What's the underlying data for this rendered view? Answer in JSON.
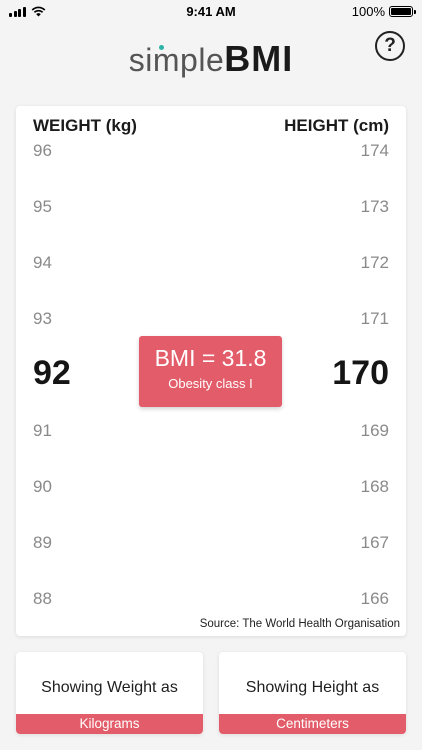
{
  "status": {
    "time": "9:41 AM",
    "battery": "100%"
  },
  "header": {
    "logo_light": "simple",
    "logo_bold": "BMI",
    "help_label": "?"
  },
  "scales": {
    "weight_header": "WEIGHT (kg)",
    "height_header": "HEIGHT (cm)",
    "weights": [
      "96",
      "95",
      "94",
      "93",
      "92",
      "91",
      "90",
      "89",
      "88"
    ],
    "heights": [
      "174",
      "173",
      "172",
      "171",
      "170",
      "169",
      "168",
      "167",
      "166"
    ],
    "selected_weight": "92",
    "selected_height": "170"
  },
  "result": {
    "bmi_text": "BMI = 31.8",
    "classification": "Obesity class I"
  },
  "source": "Source: The World Health Organisation",
  "units": {
    "weight_label": "Showing Weight as",
    "weight_unit": "Kilograms",
    "height_label": "Showing Height as",
    "height_unit": "Centimeters"
  },
  "colors": {
    "accent": "#e25c69",
    "logo_dot": "#2bb3a6"
  }
}
